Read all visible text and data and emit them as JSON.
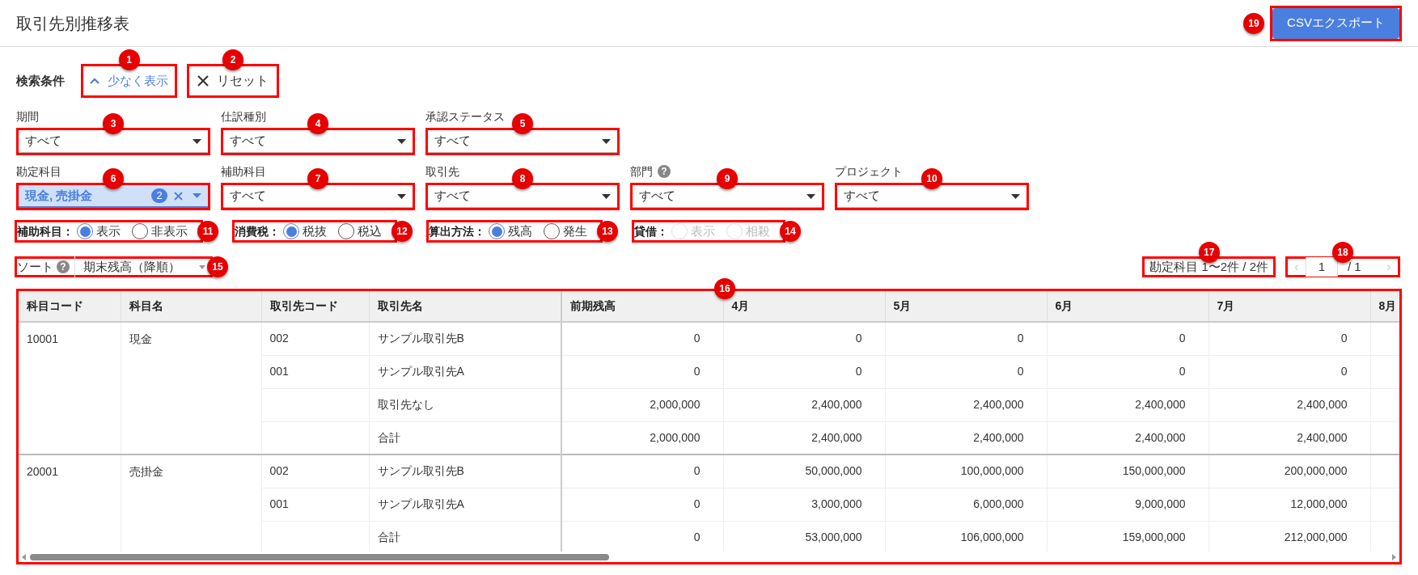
{
  "header": {
    "title": "取引先別推移表",
    "export_button": {
      "label": "CSVエクスポート",
      "annotation": "19"
    }
  },
  "search": {
    "heading": "検索条件",
    "toggle": {
      "label": "少なく表示",
      "annotation": "1"
    },
    "reset": {
      "label": "リセット",
      "annotation": "2"
    }
  },
  "filter_rows": [
    [
      {
        "kind": "select",
        "label": "期間",
        "value": "すべて",
        "annotation": "3"
      },
      {
        "kind": "select",
        "label": "仕訳種別",
        "value": "すべて",
        "annotation": "4"
      },
      {
        "kind": "select",
        "label": "承認ステータス",
        "value": "すべて",
        "annotation": "5"
      }
    ],
    [
      {
        "kind": "multi",
        "label": "勘定科目",
        "value": "現金, 売掛金",
        "count": "2",
        "annotation": "6"
      },
      {
        "kind": "select",
        "label": "補助科目",
        "value": "すべて",
        "annotation": "7"
      },
      {
        "kind": "select",
        "label": "取引先",
        "value": "すべて",
        "annotation": "8"
      },
      {
        "kind": "select",
        "label": "部門",
        "help": "?",
        "value": "すべて",
        "annotation": "9"
      },
      {
        "kind": "select",
        "label": "プロジェクト",
        "value": "すべて",
        "annotation": "10"
      }
    ]
  ],
  "radio_groups": [
    {
      "label": "補助科目：",
      "disabled": false,
      "annotation": "11",
      "options": [
        {
          "label": "表示",
          "selected": true
        },
        {
          "label": "非表示",
          "selected": false
        }
      ]
    },
    {
      "label": "消費税：",
      "disabled": false,
      "annotation": "12",
      "options": [
        {
          "label": "税抜",
          "selected": true
        },
        {
          "label": "税込",
          "selected": false
        }
      ]
    },
    {
      "label": "算出方法：",
      "disabled": false,
      "annotation": "13",
      "options": [
        {
          "label": "残高",
          "selected": true
        },
        {
          "label": "発生",
          "selected": false
        }
      ]
    },
    {
      "label": "貸借：",
      "disabled": true,
      "annotation": "14",
      "options": [
        {
          "label": "表示",
          "selected": false
        },
        {
          "label": "相殺",
          "selected": false
        }
      ]
    }
  ],
  "sort": {
    "label": "ソート",
    "help": "?",
    "value": "期末残高（降順）",
    "annotation": "15"
  },
  "range": {
    "text": "勘定科目 1〜2件 / 2件",
    "annotation": "17"
  },
  "pager": {
    "prev": "‹",
    "page": "1",
    "total": "/ 1",
    "next": "›",
    "annotation": "18"
  },
  "table": {
    "annotation": "16",
    "columns": [
      "科目コード",
      "科目名",
      "取引先コード",
      "取引先名",
      "前期残高",
      "4月",
      "5月",
      "6月",
      "7月",
      "8月"
    ],
    "groups": [
      {
        "code": "10001",
        "name": "現金",
        "rows": [
          {
            "partner_code": "002",
            "partner_name": "サンプル取引先B",
            "values": [
              "0",
              "0",
              "0",
              "0",
              "0"
            ]
          },
          {
            "partner_code": "001",
            "partner_name": "サンプル取引先A",
            "values": [
              "0",
              "0",
              "0",
              "0",
              "0"
            ]
          },
          {
            "partner_name": "取引先なし",
            "values": [
              "2,000,000",
              "2,400,000",
              "2,400,000",
              "2,400,000",
              "2,400,000"
            ]
          },
          {
            "partner_name": "合計",
            "values": [
              "2,000,000",
              "2,400,000",
              "2,400,000",
              "2,400,000",
              "2,400,000"
            ]
          }
        ]
      },
      {
        "code": "20001",
        "name": "売掛金",
        "rows": [
          {
            "partner_code": "002",
            "partner_name": "サンプル取引先B",
            "values": [
              "0",
              "50,000,000",
              "100,000,000",
              "150,000,000",
              "200,000,000"
            ]
          },
          {
            "partner_code": "001",
            "partner_name": "サンプル取引先A",
            "values": [
              "0",
              "3,000,000",
              "6,000,000",
              "9,000,000",
              "12,000,000"
            ]
          },
          {
            "partner_name": "合計",
            "values": [
              "0",
              "53,000,000",
              "106,000,000",
              "159,000,000",
              "212,000,000"
            ]
          }
        ]
      }
    ]
  }
}
